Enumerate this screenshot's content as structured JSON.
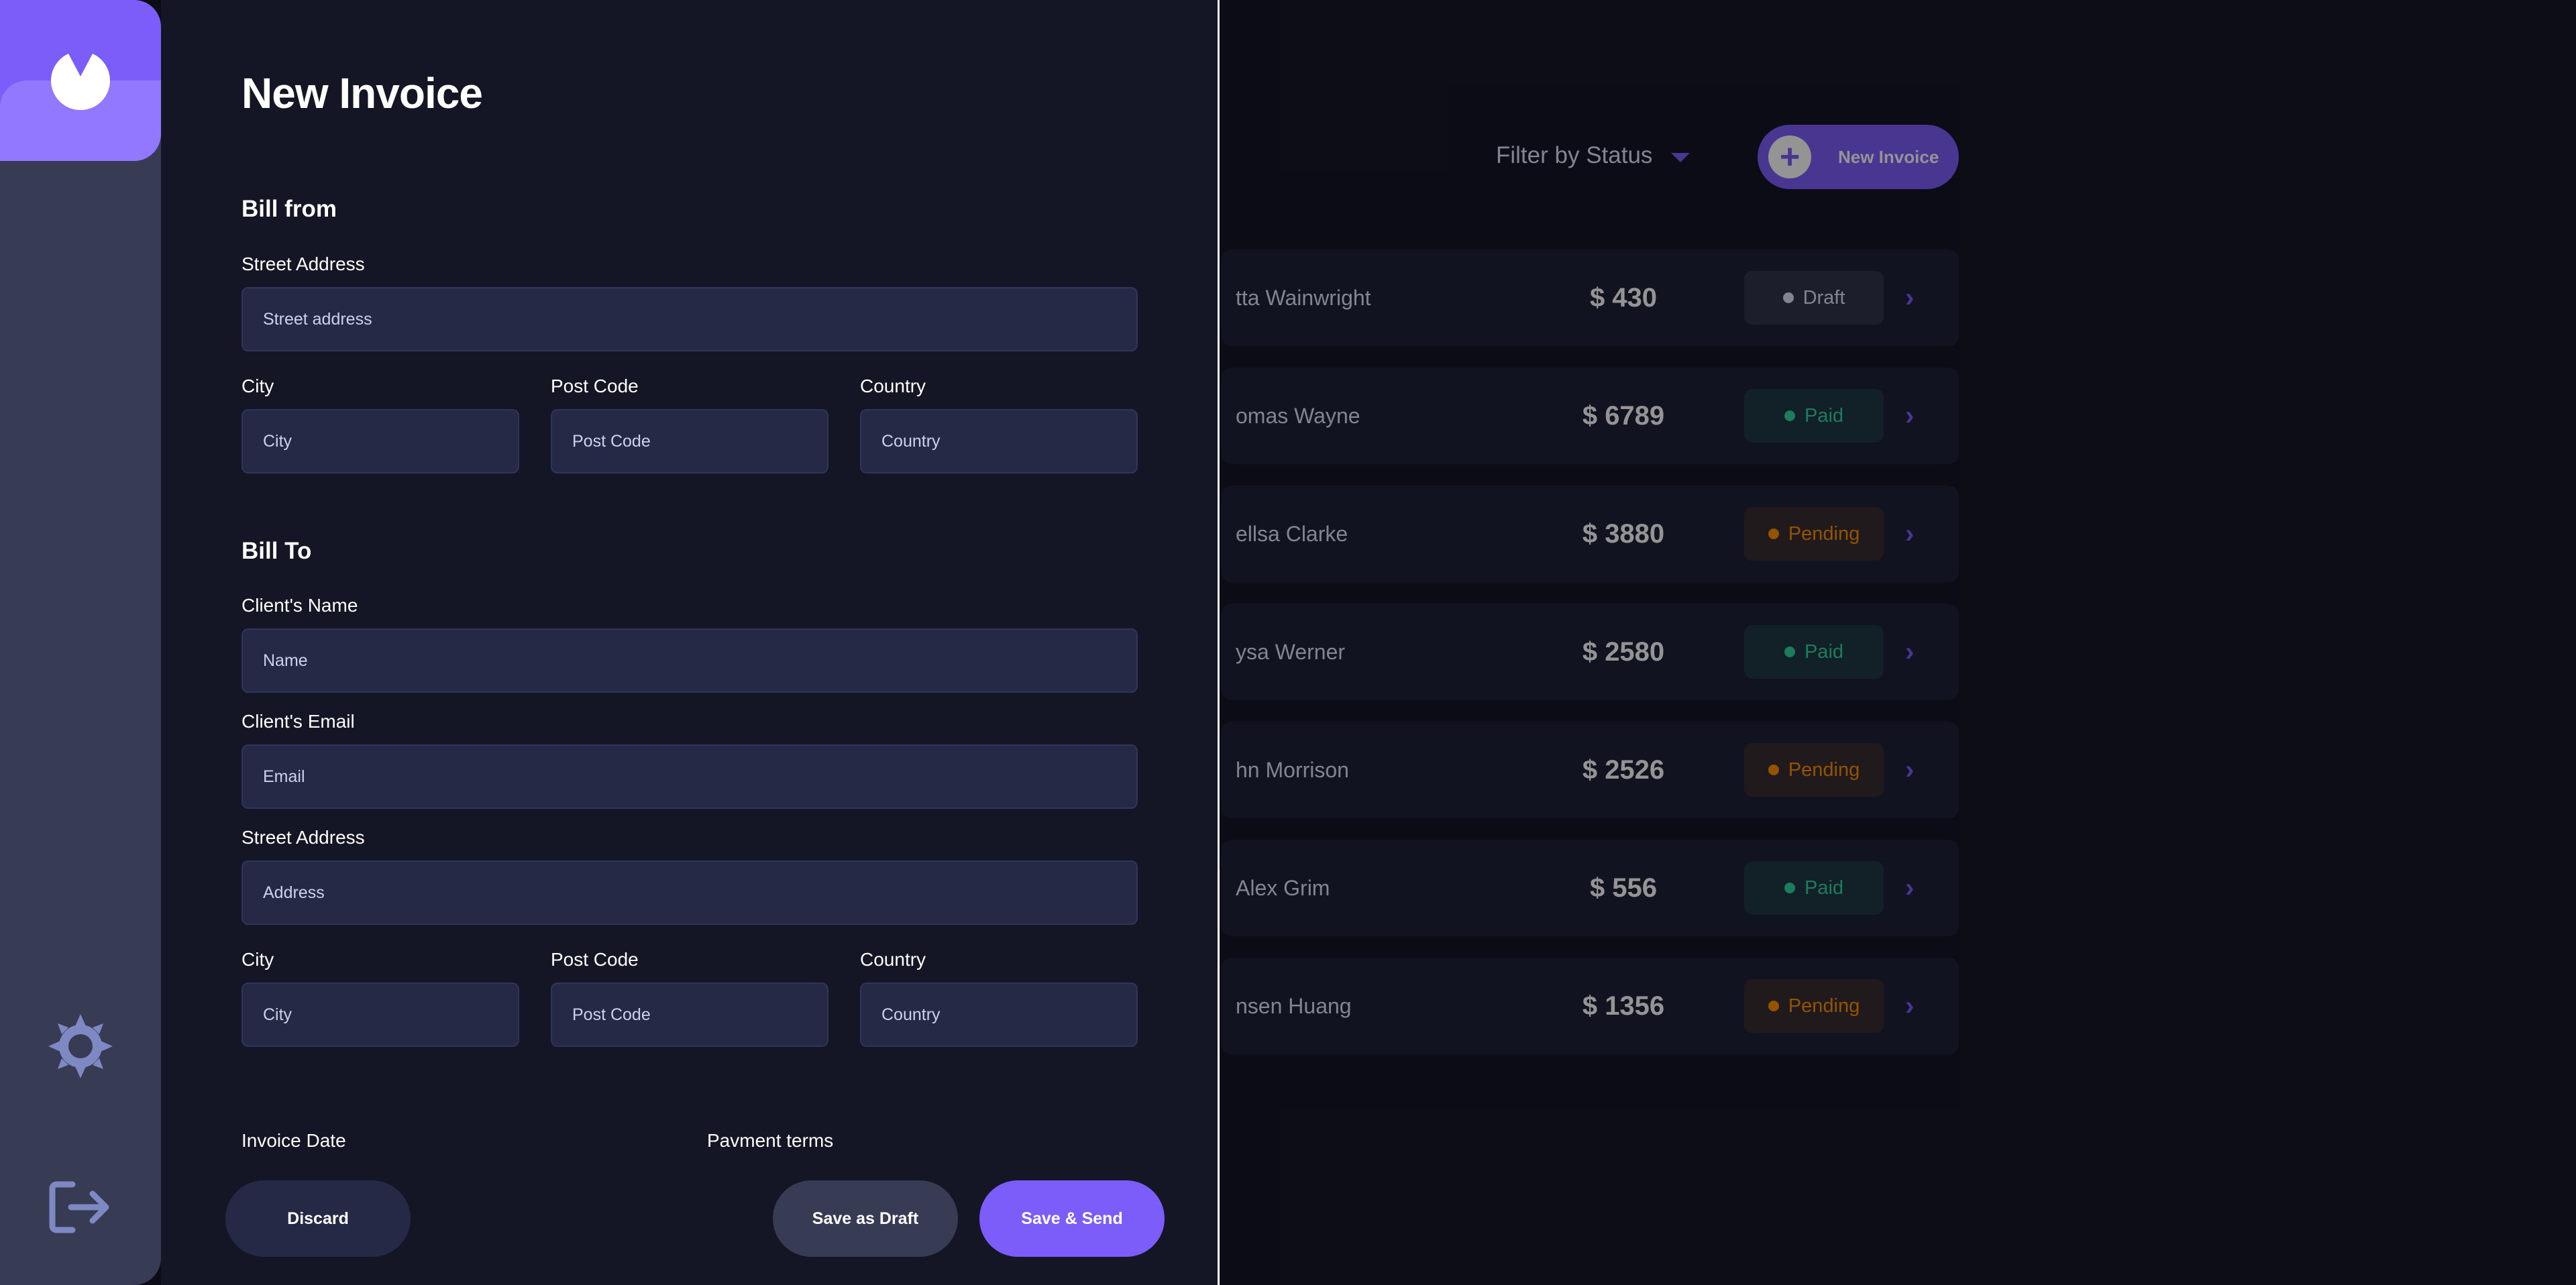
{
  "background": {
    "filter_label": "Filter by Status",
    "new_invoice_label": "New Invoice",
    "invoices": [
      {
        "client": "tta Wainwright",
        "amount": "$ 430",
        "status": "Draft",
        "status_type": "draft"
      },
      {
        "client": "omas Wayne",
        "amount": "$ 6789",
        "status": "Paid",
        "status_type": "paid"
      },
      {
        "client": "ellsa Clarke",
        "amount": "$ 3880",
        "status": "Pending",
        "status_type": "pending"
      },
      {
        "client": "ysa Werner",
        "amount": "$ 2580",
        "status": "Paid",
        "status_type": "paid"
      },
      {
        "client": "hn Morrison",
        "amount": "$ 2526",
        "status": "Pending",
        "status_type": "pending"
      },
      {
        "client": "Alex Grim",
        "amount": "$ 556",
        "status": "Paid",
        "status_type": "paid"
      },
      {
        "client": "nsen Huang",
        "amount": "$ 1356",
        "status": "Pending",
        "status_type": "pending"
      }
    ]
  },
  "sidebar": {
    "logo_icon": "logo-icon",
    "theme_icon": "sun-icon",
    "logout_icon": "logout-icon"
  },
  "form": {
    "title": "New Invoice",
    "bill_from": {
      "heading": "Bill from",
      "street_label": "Street Address",
      "street_placeholder": "Street address",
      "city_label": "City",
      "city_placeholder": "City",
      "postcode_label": "Post Code",
      "postcode_placeholder": "Post Code",
      "country_label": "Country",
      "country_placeholder": "Country"
    },
    "bill_to": {
      "heading": "Bill To",
      "name_label": "Client's Name",
      "name_placeholder": "Name",
      "email_label": "Client's Email",
      "email_placeholder": "Email",
      "street_label": "Street Address",
      "street_placeholder": "Address",
      "city_label": "City",
      "city_placeholder": "City",
      "postcode_label": "Post Code",
      "postcode_placeholder": "Post Code",
      "country_label": "Country",
      "country_placeholder": "Country"
    },
    "invoice_date_label": "Invoice Date",
    "payment_terms_label": "Pavment terms",
    "discard_label": "Discard",
    "draft_label": "Save as Draft",
    "send_label": "Save & Send"
  },
  "colors": {
    "accent": "#7c5dfa",
    "background": "#141625",
    "input_bg": "#252945",
    "paid": "#33d69f",
    "pending": "#ff8f00",
    "draft": "#dfe3fa"
  }
}
